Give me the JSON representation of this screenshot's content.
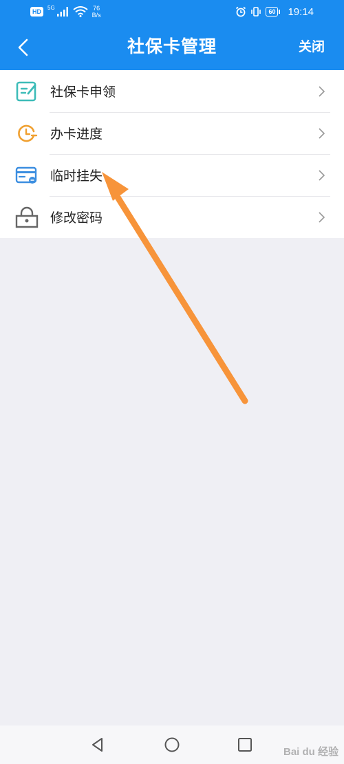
{
  "status_bar": {
    "hd": "HD",
    "network_generation": "5G",
    "speed_value": "76",
    "speed_unit": "B/s",
    "battery": "60",
    "time": "19:14"
  },
  "nav": {
    "title": "社保卡管理",
    "close_label": "关闭"
  },
  "menu": {
    "items": [
      {
        "label": "社保卡申领",
        "icon": "edit-form-icon",
        "color": "#3dbcb8"
      },
      {
        "label": "办卡进度",
        "icon": "clock-progress-icon",
        "color": "#f0a030"
      },
      {
        "label": "临时挂失",
        "icon": "card-icon",
        "color": "#3b8ee0"
      },
      {
        "label": "修改密码",
        "icon": "lock-icon",
        "color": "#666666"
      }
    ]
  },
  "watermark": "Bai du 经验",
  "colors": {
    "header": "#1a8cf0",
    "background": "#efeff4",
    "arrow": "#f7943a"
  }
}
